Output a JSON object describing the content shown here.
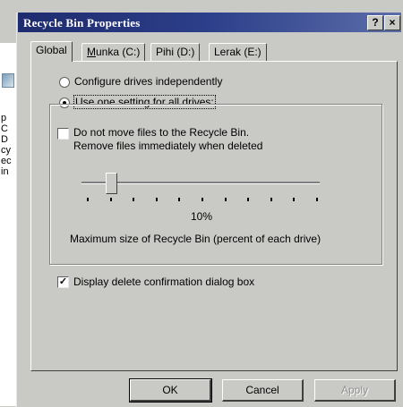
{
  "window": {
    "title": "Recycle Bin Properties",
    "help_glyph": "?",
    "close_glyph": "×"
  },
  "background": {
    "letters": [
      "p",
      "C",
      "D",
      "cy",
      "ec",
      "in"
    ]
  },
  "tabs": [
    {
      "label": "Global"
    },
    {
      "label": "Munka (C:)"
    },
    {
      "label": "Pihi (D:)"
    },
    {
      "label": "Lerak (E:)"
    }
  ],
  "options": {
    "configure_independently": "Configure drives independently",
    "use_one_setting": "Use one setting for all drives:"
  },
  "group": {
    "do_not_move_line1": "Do not move files to the Recycle Bin.",
    "do_not_move_line2": "Remove files immediately when deleted",
    "slider_percent_label": "10%",
    "slider_value": 0.1,
    "max_size_label": "Maximum size of Recycle Bin (percent of each drive)"
  },
  "display_confirm": "Display delete confirmation dialog box",
  "buttons": {
    "ok": "OK",
    "cancel": "Cancel",
    "apply": "Apply"
  }
}
